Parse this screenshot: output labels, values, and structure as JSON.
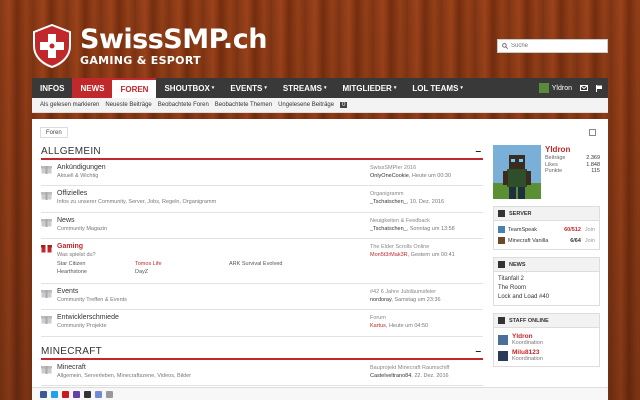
{
  "header": {
    "site_title": "SwissSMP.ch",
    "site_subtitle": "GAMING & ESPORT",
    "search_placeholder": "Suche"
  },
  "nav": {
    "items": [
      {
        "label": "INFOS",
        "caret": ""
      },
      {
        "label": "NEWS",
        "caret": ""
      },
      {
        "label": "FOREN",
        "caret": ""
      },
      {
        "label": "SHOUTBOX",
        "caret": "▾"
      },
      {
        "label": "EVENTS",
        "caret": "▾"
      },
      {
        "label": "STREAMS",
        "caret": "▾"
      },
      {
        "label": "MITGLIEDER",
        "caret": "▾"
      },
      {
        "label": "LOL TEAMS",
        "caret": "▾"
      }
    ],
    "user": "Yldron",
    "subnav": [
      "Als gelesen markieren",
      "Neueste Beiträge",
      "Beobachtete Foren",
      "Beobachtete Themen",
      "Ungelesene Beiträge"
    ],
    "unread_count": "0"
  },
  "breadcrumb": "Foren",
  "sections": [
    {
      "title": "ALLGEMEIN",
      "toggle": "–",
      "forums": [
        {
          "title": "Ankündigungen",
          "desc": "Aktuell & Wichtig",
          "last_title": "SwissSMPler 2016",
          "last_user": "OnlyOneCookie",
          "last_date": ", Heute um 00:30"
        },
        {
          "title": "Offizielles",
          "desc": "Infos zu unserer Community, Server, Jobs, Regeln, Organigramm",
          "last_title": "Organigramm",
          "last_user": "_Tschatschen_",
          "last_date": ", 10. Dez. 2016"
        },
        {
          "title": "News",
          "desc": "Community Magazin",
          "last_title": "Neuigkeiten & Feedback",
          "last_user": "_Tschatschen_",
          "last_date": ", Sonntag um 13:58"
        },
        {
          "title": "Gaming",
          "desc": "Was spielst du?",
          "last_title": "The Elder Scrolls Online",
          "last_user": "Mon5t3rMak3R",
          "last_date": ", Gestern um 00:41",
          "hot": true,
          "subforums": [
            "Star Citizen",
            "Tomos Life",
            "ARK Survival Evolved",
            "Hearthstone",
            "DayZ",
            ""
          ]
        },
        {
          "title": "Events",
          "desc": "Community Treffen & Events",
          "last_title": "#42 6 Jahre Jubiläumsfeier",
          "last_user": "nordoray",
          "last_date": ", Samstag um 23:36"
        },
        {
          "title": "Entwicklerschmiede",
          "desc": "Community Projekte",
          "last_title": "Forum",
          "last_user": "Kartus",
          "last_date": ", Heute um 04:50"
        }
      ]
    },
    {
      "title": "MINECRAFT",
      "toggle": "–",
      "forums": [
        {
          "title": "Minecraft",
          "desc": "Allgemein, Serverleben, Minecraftszene, Videos, Bilder",
          "last_title": "Bauprojekt Minecraft Raumschiff",
          "last_user": "Castelveltrano84",
          "last_date": ", 22. Dez. 2016"
        }
      ]
    }
  ],
  "sidebar": {
    "profile_name": "Yldron",
    "stats": [
      {
        "label": "Beiträge",
        "value": "2.369"
      },
      {
        "label": "Likes",
        "value": "1.848"
      },
      {
        "label": "Punkte",
        "value": "115"
      }
    ],
    "server": {
      "title": "SERVER",
      "rows": [
        {
          "name": "TeamSpeak",
          "count": "60/512",
          "join": "Join"
        },
        {
          "name": "Minecraft Vanilla",
          "count": "6/64",
          "join": "Join"
        }
      ]
    },
    "news": {
      "title": "NEWS",
      "items": [
        "Titanfall 2",
        "The Room",
        "Lock and Load #40"
      ]
    },
    "staff": {
      "title": "STAFF ONLINE",
      "members": [
        {
          "name": "Yldron",
          "role": "Koordination"
        },
        {
          "name": "Milu8123",
          "role": "Koordination"
        }
      ]
    }
  },
  "colors": {
    "brand_red": "#c0282c",
    "nav_dark": "#393939"
  }
}
